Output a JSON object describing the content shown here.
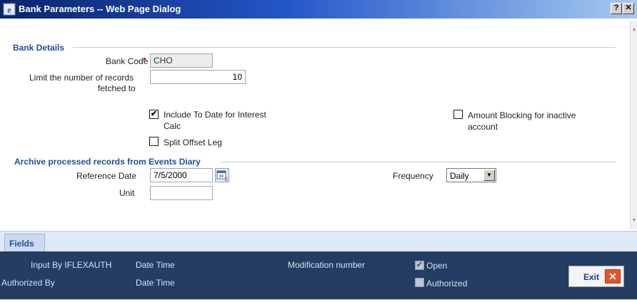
{
  "window": {
    "title": "Bank Parameters -- Web Page Dialog",
    "help_label": "?",
    "close_label": "✕"
  },
  "bank_details": {
    "section_title": "Bank Details",
    "bank_code_label": "Bank Code",
    "required_marker": "*",
    "bank_code_value": "CHO",
    "limit_label_line1": "Limit the number of records",
    "limit_label_line2": "fetched to",
    "limit_value": "10",
    "include_to_date_label_line1": "Include To Date for Interest",
    "include_to_date_label_line2": "Calc",
    "include_to_date_checked": true,
    "split_offset_leg_label": "Split Offset Leg",
    "split_offset_leg_checked": false,
    "amount_blocking_label_line1": "Amount Blocking for inactive",
    "amount_blocking_label_line2": "account",
    "amount_blocking_checked": false
  },
  "archive": {
    "section_title": "Archive processed records from Events Diary",
    "reference_date_label": "Reference Date",
    "reference_date_value": "7/5/2000",
    "unit_label": "Unit",
    "unit_value": "",
    "frequency_label": "Frequency",
    "frequency_value": "Daily"
  },
  "tabs": {
    "fields_label": "Fields"
  },
  "footer": {
    "input_by_label": "Input By IFLEXAUTH",
    "date_time_label_1": "Date Time",
    "authorized_by_label": "Authorized By",
    "date_time_label_2": "Date Time",
    "modification_number_label": "Modification number",
    "open_label": "Open",
    "open_checked": true,
    "authorized_label": "Authorized",
    "authorized_checked": false,
    "exit_label": "Exit"
  },
  "colors": {
    "section_title": "#1f4e9c",
    "footer_bg": "#233d63",
    "required_marker": "#e00000",
    "exit_icon": "#e8502a"
  },
  "icons": {
    "app": "ie-dialog-icon",
    "calendar": "calendar-icon",
    "dropdown": "chevron-down-icon",
    "exit": "close-x-icon"
  }
}
